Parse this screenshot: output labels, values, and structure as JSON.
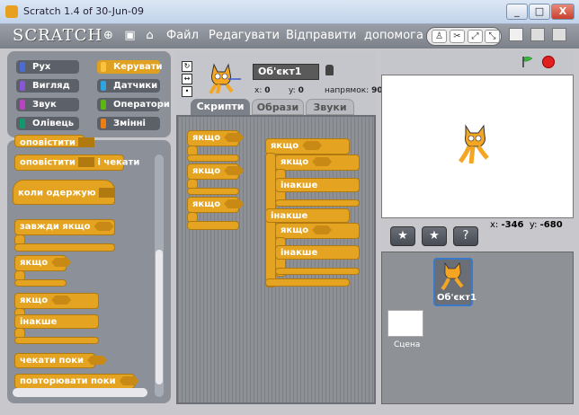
{
  "window": {
    "title": "Scratch 1.4 of 30-Jun-09",
    "min": "_",
    "max": "□",
    "close": "X"
  },
  "menubar": {
    "logo": "SCRATCH",
    "items": [
      "Файл",
      "Редагувати",
      "Відправити",
      "допомога"
    ]
  },
  "categories": [
    {
      "label": "Рух",
      "color": "#4a6cd4",
      "selected": false
    },
    {
      "label": "Керувати",
      "color": "#e0a020",
      "selected": true
    },
    {
      "label": "Вигляд",
      "color": "#8a55d7",
      "selected": false
    },
    {
      "label": "Датчики",
      "color": "#2ca5e2",
      "selected": false
    },
    {
      "label": "Звук",
      "color": "#bb42c3",
      "selected": false
    },
    {
      "label": "Оператори",
      "color": "#5cb712",
      "selected": false
    },
    {
      "label": "Олівець",
      "color": "#0e9a6c",
      "selected": false
    },
    {
      "label": "Змінні",
      "color": "#ee7d16",
      "selected": false
    }
  ],
  "palette_blocks": {
    "b1": "оповістити",
    "b2": "оповістити",
    "b2b": "і чекати",
    "b3": "коли одержую",
    "b4": "завжди якщо",
    "b5": "якщо",
    "b6": "якщо",
    "b6else": "інакше",
    "b7": "чекати поки",
    "b8": "повторювати поки"
  },
  "sprite": {
    "name": "Об'єкт1",
    "x_label": "x:",
    "x_value": "0",
    "y_label": "y:",
    "y_value": "0",
    "direction_label": "напрямок:",
    "direction_value": "90"
  },
  "tabs": [
    "Скрипти",
    "Образи",
    "Звуки"
  ],
  "scripts": {
    "if1": "якщо",
    "if2": "якщо",
    "if3": "якщо",
    "big_if": "якщо",
    "big_inner_if": "якщо",
    "big_inner_else": "інакше",
    "big_else": "інакше",
    "big2_if": "якщо",
    "big2_else": "інакше"
  },
  "stage": {
    "mouse_x_label": "x:",
    "mouse_x": "-346",
    "mouse_y_label": "y:",
    "mouse_y": "-680"
  },
  "sprite_list": {
    "sprite_name": "Об'єкт1",
    "stage_label": "Сцена"
  }
}
